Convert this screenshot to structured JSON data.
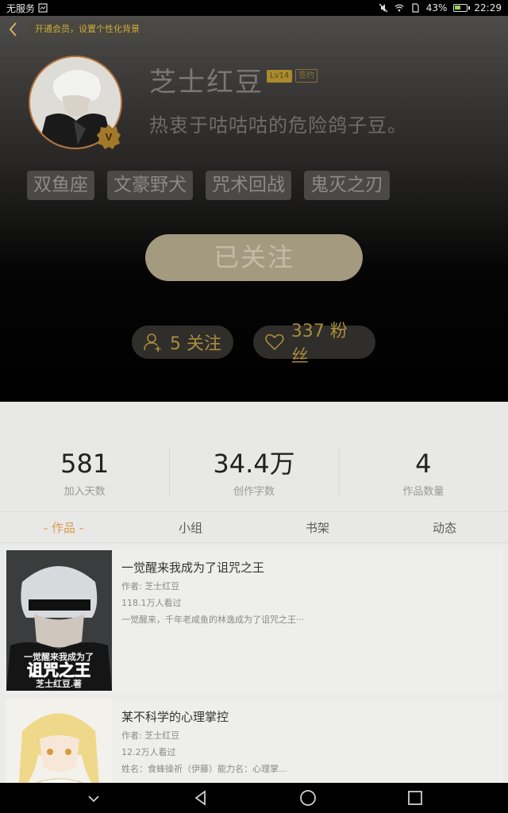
{
  "status_bar": {
    "carrier": "无服务",
    "battery": "43%",
    "time": "22:29"
  },
  "header": {
    "vip_banner": "开通会员，设置个性化背景",
    "username": "芝士红豆",
    "level": "Lv14",
    "sign_badge": "签约",
    "bio": "热衷于咕咕咕的危险鸽子豆。",
    "tags": [
      "双鱼座",
      "文豪野犬",
      "咒术回战",
      "鬼灭之刃"
    ],
    "follow_button": "已关注",
    "following": "5 关注",
    "fans": "337 粉丝"
  },
  "stats": [
    {
      "value": "581",
      "label": "加入天数"
    },
    {
      "value": "34.4万",
      "label": "创作字数"
    },
    {
      "value": "4",
      "label": "作品数量"
    }
  ],
  "tabs": [
    "- 作品 -",
    "小组",
    "书架",
    "动态"
  ],
  "books": [
    {
      "title": "一觉醒来我成为了诅咒之王",
      "author": "作者: 芝士红豆",
      "views": "118.1万人看过",
      "desc": "一觉醒来，千年老咸鱼的林逸成为了诅咒之王···",
      "cover_text_1": "一觉醒来我成为了",
      "cover_text_2": "诅咒之王",
      "cover_text_3": "芝士红豆.著"
    },
    {
      "title": "某不科学的心理掌控",
      "author": "作者: 芝士红豆",
      "views": "12.2万人看过",
      "desc": "姓名：食蜂操祈（伊藤）能力名：心理掌..."
    }
  ],
  "colors": {
    "accent_gold": "#a98d3a",
    "active_tab": "#d99a4e"
  }
}
